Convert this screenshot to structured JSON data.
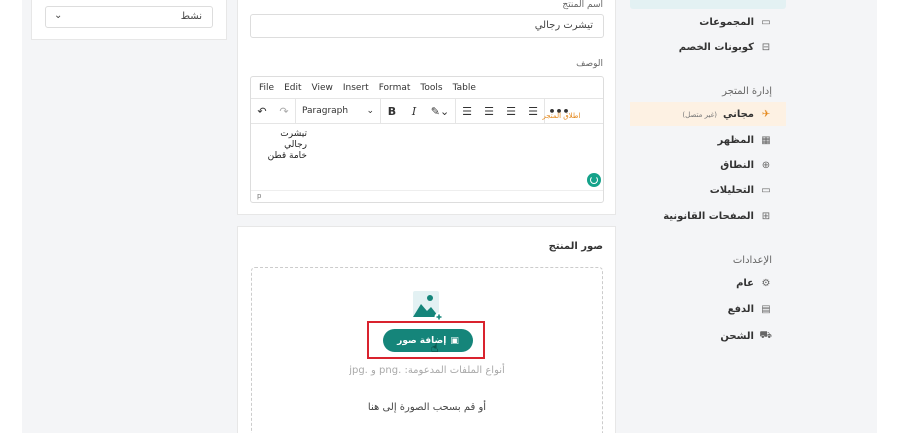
{
  "status_card": {
    "selected_status": "نشط"
  },
  "product_info": {
    "name_label": "اسم المنتج",
    "name_value": "تيشرت رجالي",
    "description_label": "الوصف",
    "editor_menu": [
      "File",
      "Edit",
      "View",
      "Insert",
      "Format",
      "Tools",
      "Table"
    ],
    "paragraph_select": "Paragraph",
    "description_lines": [
      "تيشرت رجالي",
      "خامة قطن"
    ],
    "status_path": "p"
  },
  "product_images": {
    "title": "صور المنتج",
    "add_button": "إضافة صور",
    "file_types": "أنواع الملفات المدعومة: .png و .jpg",
    "drag_hint": "أو قم بسحب الصورة إلى هنا"
  },
  "sidebar": {
    "items_top": [
      {
        "label": "المجموعات",
        "icon": "folder-icon"
      },
      {
        "label": "كوبونات الخصم",
        "icon": "coupon-icon"
      }
    ],
    "store_section": "إدارة المتجر",
    "plan_item": {
      "label": "مجاني",
      "sub": "(غير متصل)",
      "tag": "اطلاق المتجر"
    },
    "store_items": [
      {
        "label": "المظهر",
        "icon": "appearance-icon"
      },
      {
        "label": "النطاق",
        "icon": "globe-icon"
      },
      {
        "label": "التحليلات",
        "icon": "analytics-icon"
      },
      {
        "label": "الصفحات القانونية",
        "icon": "legal-pages-icon"
      }
    ],
    "settings_section": "الإعدادات",
    "settings_items": [
      {
        "label": "عام",
        "icon": "gear-icon"
      },
      {
        "label": "الدفع",
        "icon": "payment-icon"
      },
      {
        "label": "الشحن",
        "icon": "truck-icon"
      }
    ]
  },
  "colors": {
    "accent": "#15857a",
    "highlight": "#d9232e",
    "plan_bg": "#fdf1e3"
  }
}
